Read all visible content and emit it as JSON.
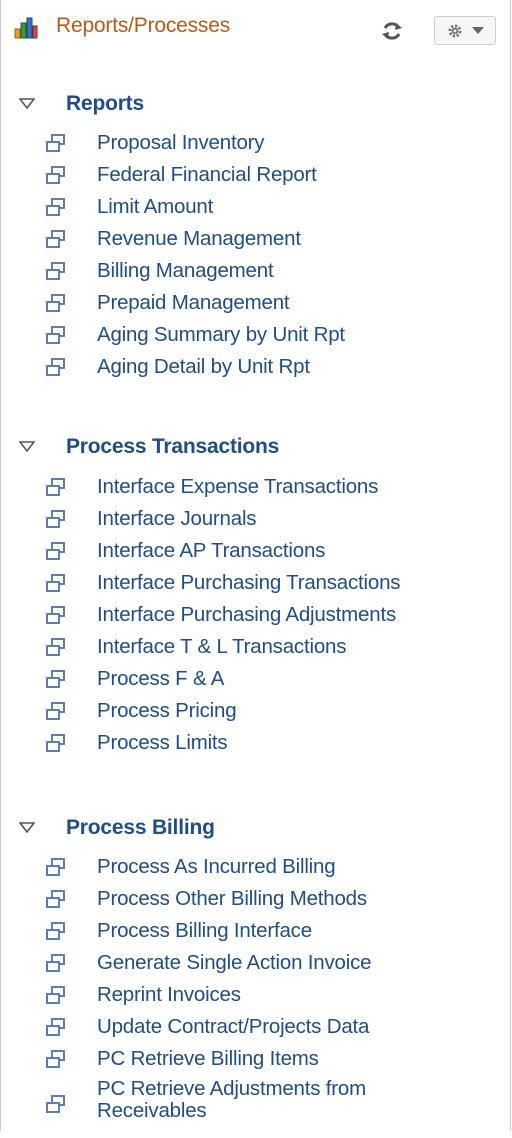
{
  "header": {
    "title": "Reports/Processes",
    "logo_icon": "bar-chart-icon",
    "refresh_icon": "refresh-icon",
    "options_icon": "gear-icon"
  },
  "colors": {
    "title": "#b85a1c",
    "link": "#1f4d86",
    "icon": "#5a7fb0"
  },
  "sections": [
    {
      "title": "Reports",
      "items": [
        "Proposal Inventory",
        "Federal Financial Report",
        "Limit Amount",
        "Revenue Management",
        "Billing Management",
        "Prepaid Management",
        "Aging Summary by Unit Rpt",
        "Aging Detail by Unit Rpt"
      ]
    },
    {
      "title": "Process Transactions",
      "items": [
        "Interface Expense Transactions",
        "Interface Journals",
        "Interface AP Transactions",
        "Interface Purchasing Transactions",
        "Interface Purchasing Adjustments",
        "Interface T & L Transactions",
        "Process F & A",
        "Process Pricing",
        "Process Limits"
      ]
    },
    {
      "title": "Process Billing",
      "items": [
        "Process As Incurred Billing",
        "Process Other Billing Methods",
        "Process Billing Interface",
        "Generate Single Action Invoice",
        "Reprint Invoices",
        "Update Contract/Projects Data",
        "PC Retrieve Billing Items",
        "PC Retrieve Adjustments from Receivables"
      ]
    }
  ]
}
